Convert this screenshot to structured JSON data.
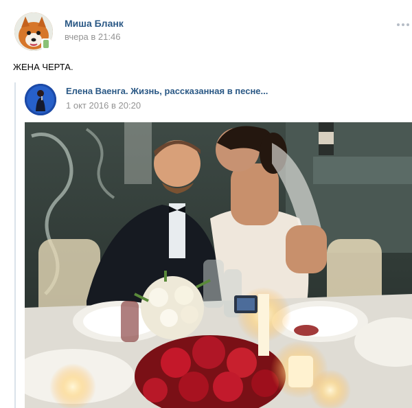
{
  "post": {
    "author_name": "Миша Бланк",
    "date": "вчера в 21:46",
    "text": "ЖЕНА ЧЕРТА.",
    "more_icon": "more-dots-icon"
  },
  "repost": {
    "author_name": "Елена Ваенга. Жизнь, рассказанная в песне...",
    "date": "1 окт 2016 в 20:20"
  },
  "colors": {
    "link": "#2a5885",
    "date": "#939393",
    "online": "#8ac176",
    "repost_bar": "#dae2ea"
  }
}
